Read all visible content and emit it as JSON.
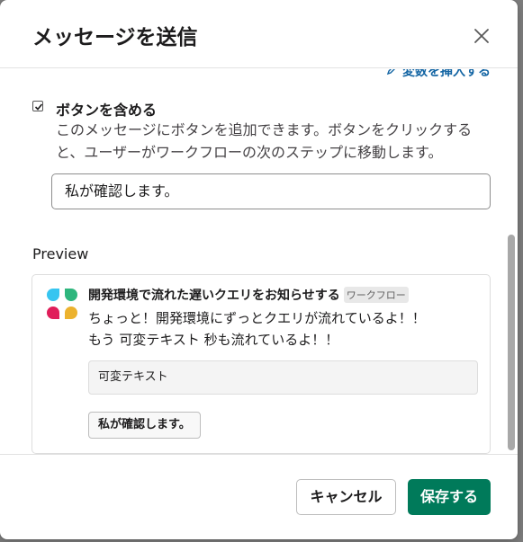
{
  "dialog": {
    "title": "メッセージを送信",
    "close_icon": "close-icon"
  },
  "insert_variable": {
    "label": "変数を挿入する",
    "icon": "pencil-icon"
  },
  "include_button": {
    "checked": true,
    "label": "ボタンを含める",
    "description": "このメッセージにボタンを追加できます。ボタンをクリックすると、ユーザーがワークフローの次のステップに移動します。",
    "button_text_value": "私が確認します。"
  },
  "preview": {
    "heading": "Preview",
    "message": {
      "title": "開発環境で流れた遅いクエリをお知らせする",
      "badge": "ワークフロー",
      "line1": "ちょっと！開発環境にずっとクエリが流れているよ！！",
      "line2": "もう 可変テキスト 秒も流れているよ！！",
      "block_text": "可変テキスト",
      "button_label": "私が確認します。"
    }
  },
  "footer": {
    "cancel_label": "キャンセル",
    "save_label": "保存する"
  },
  "colors": {
    "primary": "#007a5a",
    "link": "#1264a3"
  }
}
